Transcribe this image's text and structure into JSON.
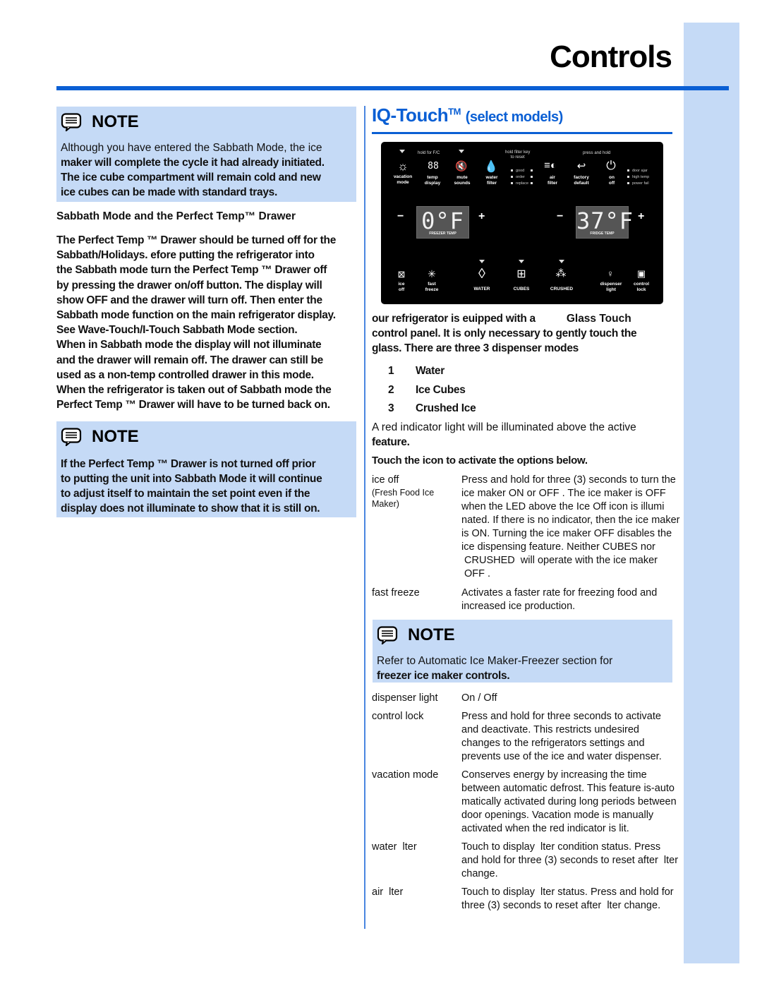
{
  "page": {
    "title": "Controls"
  },
  "notes": {
    "label": "NOTE",
    "note1": {
      "line1": "Although you have entered the Sabbath Mode, the ice",
      "line2": "maker will complete the cycle it had already initiated.",
      "line3": "The ice cube compartment will remain cold and new",
      "line4": "ice cubes can be made with standard trays."
    },
    "note2": {
      "lines": [
        "If the Perfect Temp   ™ Drawer is not turned off prior",
        "to putting the unit into Sabbath Mode it will continue",
        "to adjust itself to maintain the set point even if the",
        "display does not illuminate to show that it is still on."
      ]
    },
    "note3": {
      "line1": "Refer to Automatic Ice Maker-Freezer section for",
      "line2": "freezer ice maker controls."
    }
  },
  "sabbath": {
    "heading": "Sabbath Mode and the Perfect Temp™ Drawer",
    "lines": [
      "The Perfect Temp    ™ Drawer should be turned off for the",
      "Sabbath/Holidays.  efore putting the refrigerator into",
      "the Sabbath mode turn the Perfect Temp        ™ Drawer off",
      "by pressing the drawer    on/off button.  The display will",
      "show OFF and the drawer will turn off.  Then enter the",
      "Sabbath mode function on the main refrigerator display.",
      "See Wave-Touch/I-Touch Sabbath Mode section.",
      "When in Sabbath mode the display will not illuminate",
      "and the drawer will remain off.  The drawer can still be",
      "used as a non-temp controlled drawer in this mode.",
      "When the refrigerator is taken out of Sabbath mode the",
      "Perfect Temp   ™ Drawer will have to be turned back on."
    ]
  },
  "iq_touch": {
    "title": "IQ-Touch",
    "tm": "TM",
    "subtitle": "(select models)"
  },
  "panel": {
    "hints": {
      "hold_fc": "hold for F/C",
      "hold_filter_1": "hold filter key",
      "hold_filter_2": "to reset",
      "press_hold": "press and hold"
    },
    "top_buttons": [
      {
        "icon": "sun-icon",
        "line1": "vacation",
        "line2": "mode"
      },
      {
        "icon": "digits-icon",
        "line1": "temp",
        "line2": "display"
      },
      {
        "icon": "mute-speaker-icon",
        "line1": "mute",
        "line2": "sounds"
      },
      {
        "icon": "water-drop-icon",
        "line1": "water",
        "line2": "filter"
      },
      {
        "icon": "air-filter-icon",
        "line1": "air",
        "line2": "filter"
      },
      {
        "icon": "return-arrow-icon",
        "line1": "factory",
        "line2": "default"
      },
      {
        "icon": "power-icon",
        "line1": "on",
        "line2": "off"
      }
    ],
    "filter_status": [
      "good",
      "order",
      "replace"
    ],
    "alerts": [
      "door ajar",
      "high temp",
      "power fail"
    ],
    "freezer": {
      "value": "0°F",
      "caption": "FREEZER TEMP"
    },
    "fridge": {
      "value": "37°F",
      "caption": "FRIDGE TEMP"
    },
    "minus": "−",
    "plus": "+",
    "bottom_buttons": [
      {
        "icon": "ice-off-icon",
        "line1": "ice",
        "line2": "off"
      },
      {
        "icon": "snowflake-icon",
        "line1": "fast",
        "line2": "freeze"
      },
      {
        "icon": "water-drop-icon",
        "line1": "WATER",
        "line2": ""
      },
      {
        "icon": "ice-cubes-icon",
        "line1": "CUBES",
        "line2": ""
      },
      {
        "icon": "crushed-ice-icon",
        "line1": "CRUSHED",
        "line2": ""
      },
      {
        "icon": "light-bulb-icon",
        "line1": "dispenser",
        "line2": "light"
      },
      {
        "icon": "lock-icon",
        "line1": "control",
        "line2": "lock"
      }
    ]
  },
  "intro": {
    "line1_a": "our refrigerator is euipped with a",
    "line1_b": "Glass Touch",
    "line2": "control panel. It is only necessary to gently touch the",
    "line3": "glass.  There are three 3 dispenser modes"
  },
  "modes": [
    {
      "num": "1",
      "label": "Water"
    },
    {
      "num": "2",
      "label": "Ice Cubes"
    },
    {
      "num": "3",
      "label": "Crushed Ice"
    }
  ],
  "red_indicator": {
    "line1": "A red indicator light will be illuminated above the active",
    "line2": "feature."
  },
  "touch_heading": "Touch the icon to activate the options below.",
  "options_a": [
    {
      "term": "ice off",
      "term_sub": "(Fresh Food Ice Maker)",
      "lines": [
        "Press and hold for three (3) seconds to turn the",
        "ice maker  ON  or  OFF .  The ice maker is OFF",
        "when the LED above the  Ice Off  icon is illumi",
        "nated.  If there is no indicator, then the ice maker",
        "is ON. Turning the ice maker  OFF  disables the",
        "ice dispensing feature. Neither  CUBES  nor",
        " CRUSHED  will operate with the ice maker",
        " OFF ."
      ]
    },
    {
      "term": "fast freeze",
      "term_sub": "",
      "lines": [
        "Activates a faster rate for freezing food and",
        "increased ice production."
      ]
    }
  ],
  "options_b": [
    {
      "term": "dispenser light",
      "lines": [
        "On / Off"
      ]
    },
    {
      "term": "control lock",
      "lines": [
        "Press and hold for three seconds to activate",
        "and deactivate. This restricts undesired",
        "changes to the refrigerators settings and",
        "prevents use of the ice and water dispenser."
      ]
    },
    {
      "term": "vacation mode",
      "lines": [
        "Conserves energy by increasing the time",
        "between automatic defrost. This feature is-auto",
        "matically activated during long periods between",
        "door openings. Vacation mode is manually",
        "activated when the red indicator is lit."
      ]
    },
    {
      "term": "water  lter",
      "lines": [
        "Touch to display  lter condition status. Press",
        "and hold for three (3) seconds to reset after  lter",
        "change."
      ]
    },
    {
      "term": "air  lter",
      "lines": [
        "Touch to display  lter status. Press and hold for",
        "three (3) seconds to reset after  lter change."
      ]
    }
  ],
  "colors": {
    "accent_blue": "#0a5fd4",
    "note_bg": "#c5daf6",
    "panel_bg": "#000000"
  }
}
